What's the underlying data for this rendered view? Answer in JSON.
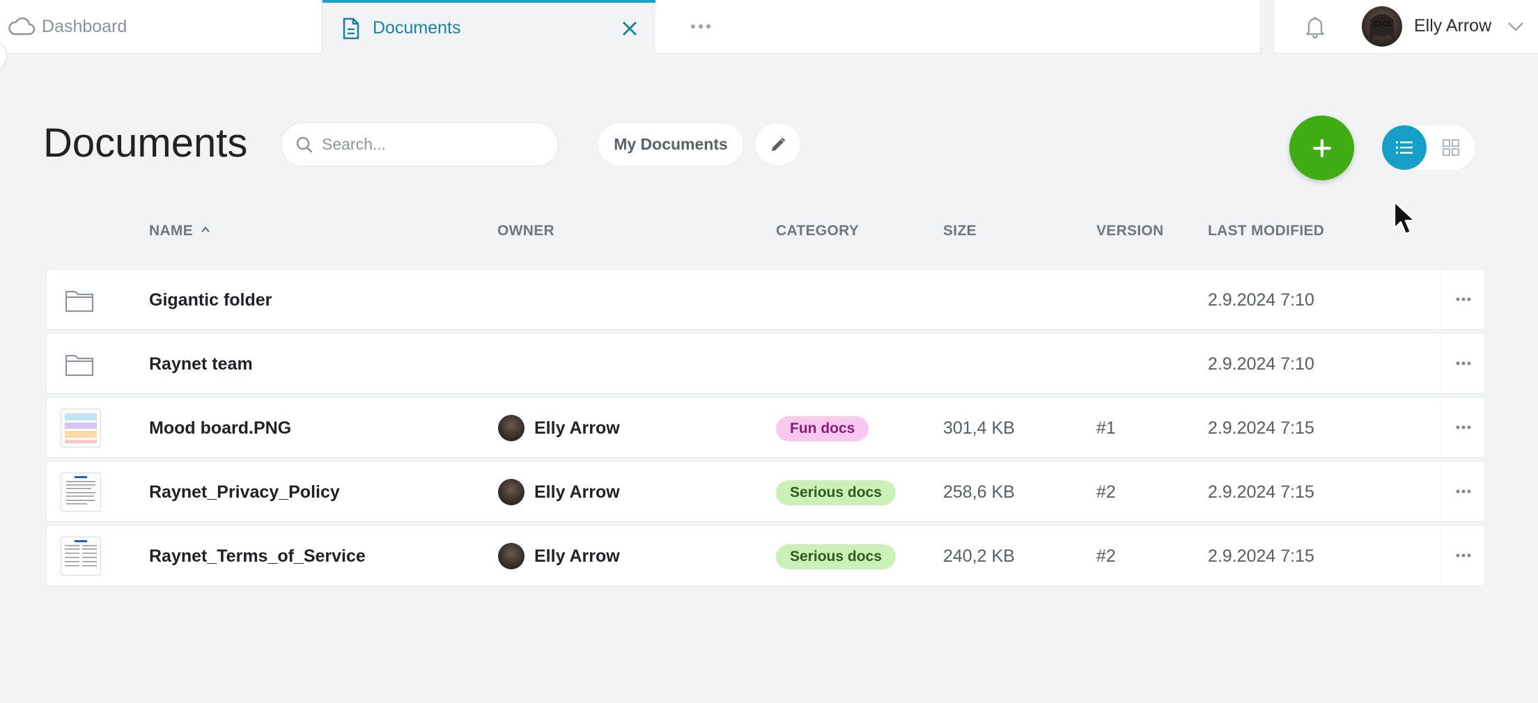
{
  "tabs": {
    "dashboard": "Dashboard",
    "documents": "Documents"
  },
  "user": {
    "name": "Elly Arrow"
  },
  "page": {
    "title": "Documents",
    "search_placeholder": "Search...",
    "filter_label": "My Documents"
  },
  "colors": {
    "accent": "#1ba3c6",
    "add_button": "#3fac14",
    "fun_badge_bg": "#f9c8ef",
    "fun_badge_text": "#8a1d73",
    "serious_badge_bg": "#ccf0b9",
    "serious_badge_text": "#2d5e17"
  },
  "table": {
    "columns": {
      "name": "NAME",
      "owner": "OWNER",
      "category": "CATEGORY",
      "size": "SIZE",
      "version": "VERSION",
      "modified": "LAST MODIFIED"
    },
    "sort": {
      "column": "name",
      "direction": "ascending"
    },
    "rows": [
      {
        "type": "folder",
        "name": "Gigantic folder",
        "owner": "",
        "category": "",
        "size": "",
        "version": "",
        "modified": "2.9.2024 7:10"
      },
      {
        "type": "folder",
        "name": "Raynet team",
        "owner": "",
        "category": "",
        "size": "",
        "version": "",
        "modified": "2.9.2024 7:10"
      },
      {
        "type": "file",
        "name": "Mood board.PNG",
        "owner": "Elly Arrow",
        "category": "Fun docs",
        "size": "301,4 KB",
        "version": "#1",
        "modified": "2.9.2024 7:15"
      },
      {
        "type": "file",
        "name": "Raynet_Privacy_Policy",
        "owner": "Elly Arrow",
        "category": "Serious docs",
        "size": "258,6 KB",
        "version": "#2",
        "modified": "2.9.2024 7:15"
      },
      {
        "type": "file",
        "name": "Raynet_Terms_of_Service",
        "owner": "Elly Arrow",
        "category": "Serious docs",
        "size": "240,2 KB",
        "version": "#2",
        "modified": "2.9.2024 7:15"
      }
    ]
  }
}
